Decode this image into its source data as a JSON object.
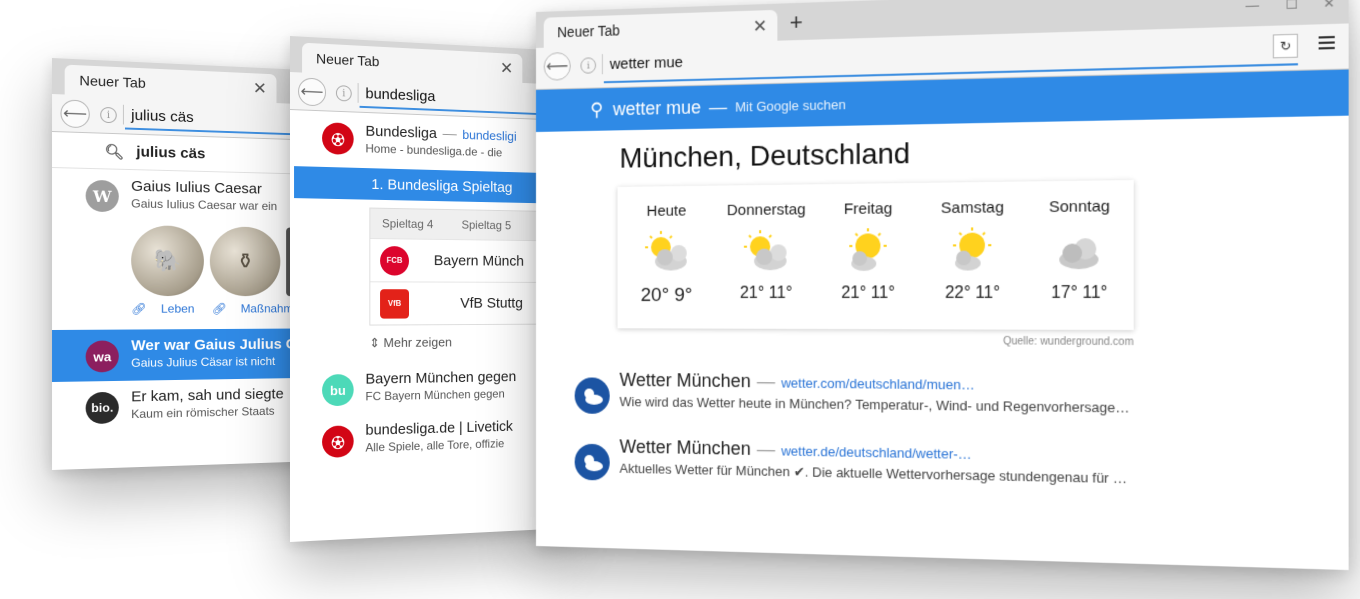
{
  "win1": {
    "tab_title": "Neuer Tab",
    "url": "julius cäs",
    "suggestion": "julius cäs",
    "results": [
      {
        "avatar": "W",
        "avatar_color": "#9e9e9e",
        "title": "Gaius Iulius Caesar",
        "subtitle": "Gaius Iulius Caesar war ein"
      },
      {
        "avatar": "wa",
        "avatar_color": "#8c1f5f",
        "title": "Wer war Gaius Julius C",
        "subtitle": "Gaius Julius Cäsar ist nicht"
      },
      {
        "avatar": "bio.",
        "avatar_color": "#2b2b2b",
        "title": "Er kam, sah und siegte",
        "subtitle": "Kaum ein römischer Staats"
      }
    ],
    "links": [
      "Leben",
      "Maßnahmen n"
    ]
  },
  "win2": {
    "tab_title": "Neuer Tab",
    "url": "bundesliga",
    "top": {
      "title": "Bundesliga",
      "url": "bundesligi",
      "subtitle": "Home - bundesliga.de - die"
    },
    "selected": "1. Bundesliga Spieltag",
    "kicker_tabs": [
      "Spieltag 4",
      "Spieltag 5"
    ],
    "teams": [
      {
        "name": "Bayern Münch",
        "crest_color": "#dc052d"
      },
      {
        "name": "VfB Stuttg",
        "crest_color": "#e32219"
      }
    ],
    "more": "Mehr zeigen",
    "results": [
      {
        "avatar": "bu",
        "avatar_color": "#4dd9b8",
        "title": "Bayern München gegen",
        "subtitle": "FC Bayern München gegen"
      },
      {
        "avatar": "",
        "avatar_color": "#d20515",
        "title": "bundesliga.de | Livetick",
        "subtitle": "Alle Spiele, alle Tore, offizie"
      }
    ]
  },
  "win3": {
    "tab_title": "Neuer Tab",
    "new_tab": "+",
    "url": "wetter mue",
    "search_query": "wetter mue",
    "search_dash": "—",
    "search_engine": "Mit Google suchen",
    "city": "München, Deutschland",
    "forecast": [
      {
        "day": "Heute",
        "icon": "partly-cloudy-icon",
        "temps": "20° 9°"
      },
      {
        "day": "Donnerstag",
        "icon": "partly-cloudy-icon",
        "temps": "21° 11°"
      },
      {
        "day": "Freitag",
        "icon": "partly-cloudy-icon",
        "temps": "21° 11°"
      },
      {
        "day": "Samstag",
        "icon": "partly-cloudy-icon",
        "temps": "22° 11°"
      },
      {
        "day": "Sonntag",
        "icon": "cloudy-icon",
        "temps": "17° 11°"
      }
    ],
    "source": "Quelle: wunderground.com",
    "results": [
      {
        "title": "Wetter München",
        "url": "wetter.com/deutschland/muen…",
        "subtitle": "Wie wird das Wetter heute in München? Temperatur-, Wind- und Regenvorhersage…"
      },
      {
        "title": "Wetter München",
        "url": "wetter.de/deutschland/wetter-…",
        "subtitle": "Aktuelles Wetter für München ✔. Die aktuelle Wettervorhersage stundengenau für …"
      }
    ]
  }
}
